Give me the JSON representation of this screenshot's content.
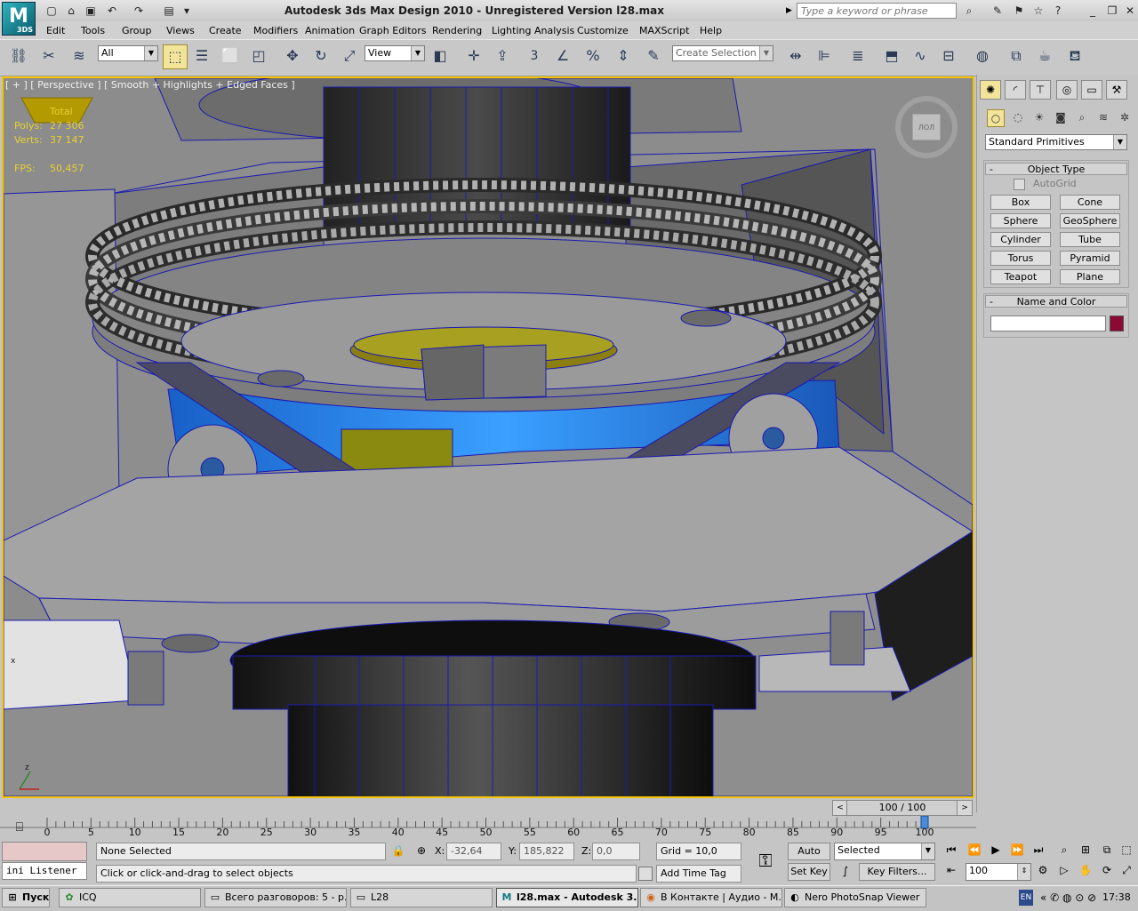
{
  "app": {
    "title": "Autodesk 3ds Max Design 2010  - Unregistered Version    l28.max",
    "logo_text": "M",
    "logo_sub": "3DS",
    "search_placeholder": "Type a keyword or phrase"
  },
  "menu": [
    "Edit",
    "Tools",
    "Group",
    "Views",
    "Create",
    "Modifiers",
    "Animation",
    "Graph Editors",
    "Rendering",
    "Lighting Analysis",
    "Customize",
    "MAXScript",
    "Help"
  ],
  "toolbar": {
    "selection_filter": "All",
    "reference_coord": "View",
    "selection_set_placeholder": "Create Selection Se",
    "snap_label": "3"
  },
  "viewport": {
    "label_plus": "[ + ]",
    "label_view": "[ Perspective ]",
    "label_shading": "[ Smooth + Highlights + Edged Faces ]",
    "stats_header": "Total",
    "polys_label": "Polys:",
    "polys_value": "27 306",
    "verts_label": "Verts:",
    "verts_value": "37 147",
    "fps_label": "FPS:",
    "fps_value": "50,457",
    "viewcube_label": "ЛОЛ",
    "axis_z": "z",
    "axis_x": "x"
  },
  "command_panel": {
    "dropdown": "Standard Primitives",
    "object_type_title": "Object Type",
    "autogrid_label": "AutoGrid",
    "primitives": [
      "Box",
      "Cone",
      "Sphere",
      "GeoSphere",
      "Cylinder",
      "Tube",
      "Torus",
      "Pyramid",
      "Teapot",
      "Plane"
    ],
    "name_color_title": "Name and Color",
    "name_value": "",
    "object_color": "#8b0a34"
  },
  "timeline": {
    "frame_counter": "100 / 100",
    "ticks": [
      "0",
      "5",
      "10",
      "15",
      "20",
      "25",
      "30",
      "35",
      "40",
      "45",
      "50",
      "55",
      "60",
      "65",
      "70",
      "75",
      "80",
      "85",
      "90",
      "95",
      "100"
    ]
  },
  "status": {
    "selection": "None Selected",
    "prompt": "Click or click-and-drag to select objects",
    "listener": "ini Listener",
    "x_label": "X:",
    "x_value": "-32,64",
    "y_label": "Y:",
    "y_value": "185,822",
    "z_label": "Z:",
    "z_value": "0,0",
    "grid": "Grid = 10,0",
    "add_time_tag": "Add Time Tag",
    "auto_key": "Auto Key",
    "set_key": "Set Key",
    "key_mode": "Selected",
    "key_filters": "Key Filters...",
    "current_frame": "100"
  },
  "taskbar": {
    "start": "Пуск",
    "tasks": [
      "ICQ",
      "Всего разговоров: 5 - р...",
      "L28",
      "l28.max - Autodesk 3...",
      "В Контакте | Аудио - М...",
      "Nero PhotoSnap Viewer"
    ],
    "lang": "EN",
    "clock": "17:38"
  },
  "colors": {
    "viewport_border": "#f3c300",
    "stats_text": "#e8d030",
    "edges": "#1a1ab0"
  }
}
